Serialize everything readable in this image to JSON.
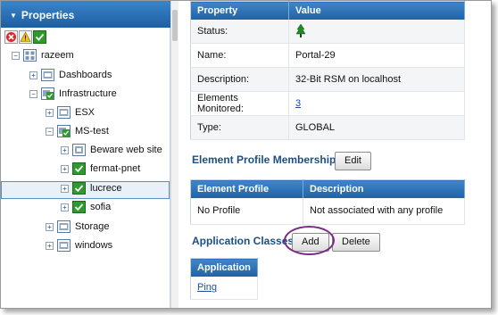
{
  "sidebar": {
    "title": "Properties",
    "status_icons": [
      "error-icon",
      "warning-icon",
      "ok-icon"
    ],
    "tree": [
      {
        "label": "razeem",
        "icon": "group-icon"
      },
      {
        "label": "Dashboards",
        "icon": "group-icon"
      },
      {
        "label": "Infrastructure",
        "icon": "group-ok-icon"
      },
      {
        "label": "ESX",
        "icon": "group-icon"
      },
      {
        "label": "MS-test",
        "icon": "group-ok-icon"
      },
      {
        "label": "Beware web site",
        "icon": "element-icon"
      },
      {
        "label": "fermat-pnet",
        "icon": "element-ok-icon"
      },
      {
        "label": "lucrece",
        "icon": "element-ok-icon"
      },
      {
        "label": "sofia",
        "icon": "element-ok-icon"
      },
      {
        "label": "Storage",
        "icon": "group-icon"
      },
      {
        "label": "windows",
        "icon": "group-icon"
      }
    ]
  },
  "properties": {
    "headers": {
      "property": "Property",
      "value": "Value"
    },
    "rows": [
      {
        "name": "Status:",
        "value": "",
        "value_icon": "tree-status-icon"
      },
      {
        "name": "Name:",
        "value": "Portal-29"
      },
      {
        "name": "Description:",
        "value": "32-Bit RSM on localhost"
      },
      {
        "name": "Elements Monitored:",
        "value": "3",
        "link": true
      },
      {
        "name": "Type:",
        "value": "GLOBAL"
      }
    ]
  },
  "profile_membership": {
    "title": "Element Profile Membership",
    "edit_label": "Edit",
    "headers": {
      "profile": "Element Profile",
      "description": "Description"
    },
    "rows": [
      {
        "profile": "No Profile",
        "description": "Not associated with any profile"
      }
    ]
  },
  "app_classes": {
    "title": "Application Classes",
    "add_label": "Add",
    "delete_label": "Delete",
    "header": "Application",
    "rows": [
      {
        "name": "Ping"
      }
    ]
  },
  "colors": {
    "header_blue": "#1f62a6",
    "section_title": "#1d4f86",
    "highlight": "#7a2b84",
    "ok_green": "#2e9a2e"
  }
}
